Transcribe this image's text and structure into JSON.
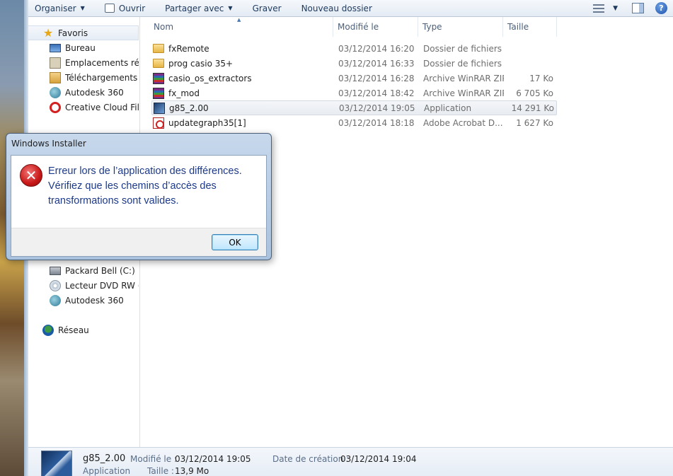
{
  "toolbar": {
    "organize": "Organiser",
    "open": "Ouvrir",
    "share": "Partager avec",
    "burn": "Graver",
    "new_folder": "Nouveau dossier",
    "help": "?"
  },
  "nav": {
    "favorites": "Favoris",
    "items_top": [
      "Bureau",
      "Emplacements récen",
      "Téléchargements",
      "Autodesk 360",
      "Creative Cloud Files"
    ],
    "items_drives": [
      "Packard Bell (C:)",
      "Lecteur DVD RW (D:)",
      "Autodesk 360"
    ],
    "network": "Réseau"
  },
  "columns": {
    "name": "Nom",
    "modified": "Modifié le",
    "type": "Type",
    "size": "Taille"
  },
  "files": [
    {
      "name": "fxRemote",
      "modified": "03/12/2014 16:20",
      "type": "Dossier de fichiers",
      "size": "",
      "icon": "folder-icon"
    },
    {
      "name": "prog casio 35+",
      "modified": "03/12/2014 16:33",
      "type": "Dossier de fichiers",
      "size": "",
      "icon": "folder-icon"
    },
    {
      "name": "casio_os_extractors",
      "modified": "03/12/2014 16:28",
      "type": "Archive WinRAR ZIP",
      "size": "17 Ko",
      "icon": "rar-archive-icon"
    },
    {
      "name": "fx_mod",
      "modified": "03/12/2014 18:42",
      "type": "Archive WinRAR ZIP",
      "size": "6 705 Ko",
      "icon": "rar-archive-icon"
    },
    {
      "name": "g85_2.00",
      "modified": "03/12/2014 19:05",
      "type": "Application",
      "size": "14 291 Ko",
      "icon": "application-icon"
    },
    {
      "name": "updategraph35[1]",
      "modified": "03/12/2014 18:18",
      "type": "Adobe Acrobat D...",
      "size": "1 627 Ko",
      "icon": "pdf-icon"
    }
  ],
  "details": {
    "name": "g85_2.00",
    "type": "Application",
    "modified_label": "Modifié le :",
    "modified_value": "03/12/2014 19:05",
    "size_label": "Taille :",
    "size_value": "13,9 Mo",
    "created_label": "Date de création :",
    "created_value": "03/12/2014 19:04"
  },
  "dialog": {
    "title": "Windows Installer",
    "message": "Erreur lors de l’application des différences. Vérifiez que les chemins d’accès des transformations sont valides.",
    "ok": "OK"
  },
  "colors": {
    "dialog_text": "#1d3a8a",
    "error_red": "#c81818",
    "toolbar_text": "#1e395b"
  }
}
